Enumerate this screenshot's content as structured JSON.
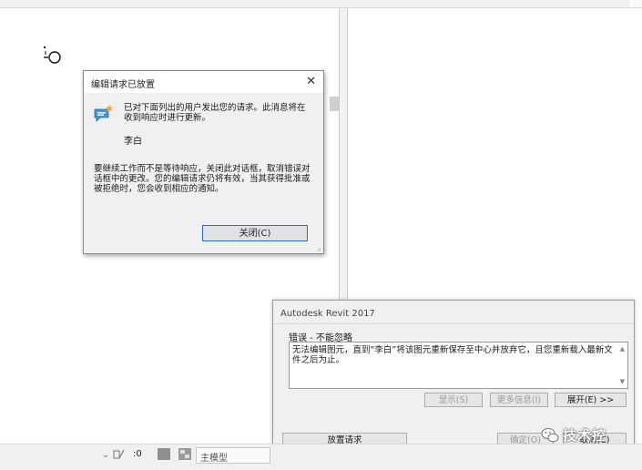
{
  "pending_dialog": {
    "title": "编辑请求已放置",
    "close_glyph": "✕",
    "message": "已对下面列出的用户发出您的请求。此消息将在收到响应时进行更新。",
    "user": "李白",
    "info": "要继续工作而不是等待响应，关闭此对话框，取消错误对话框中的更改。您的编辑请求仍将有效，当其获得批准或被拒绝时，您会收到相应的通知。",
    "close_button": "关闭(C)",
    "grip": "⣠"
  },
  "error_dialog": {
    "title": "Autodesk Revit 2017",
    "label": "错误 - 不能忽略",
    "message": "无法编辑图元，直到“李白”将该图元重新保存至中心并放弃它，且您重新载入最新文件之后为止。",
    "scroll_up": "▲",
    "scroll_down": "▼",
    "show_button": "显示(S)",
    "more_info_button": "更多信息(I)",
    "expand_button": "展开(E) >>",
    "postpone_button": "放置请求",
    "ok_button": "确定(O)",
    "cancel_button": "取消(C)"
  },
  "status_bar": {
    "chevron": "⌄",
    "count": ":0",
    "model": "主模型"
  },
  "watermark": {
    "text": "技术控"
  },
  "colors": {
    "focus_border": "#1f6fcf",
    "dialog_bg": "#f0f0f0",
    "disabled_text": "#9a9a9a"
  },
  "icons": [
    "view-origin-icon",
    "message-bubble-icon",
    "close-icon",
    "workset-icon",
    "design-option-icon",
    "wechat-icon"
  ]
}
